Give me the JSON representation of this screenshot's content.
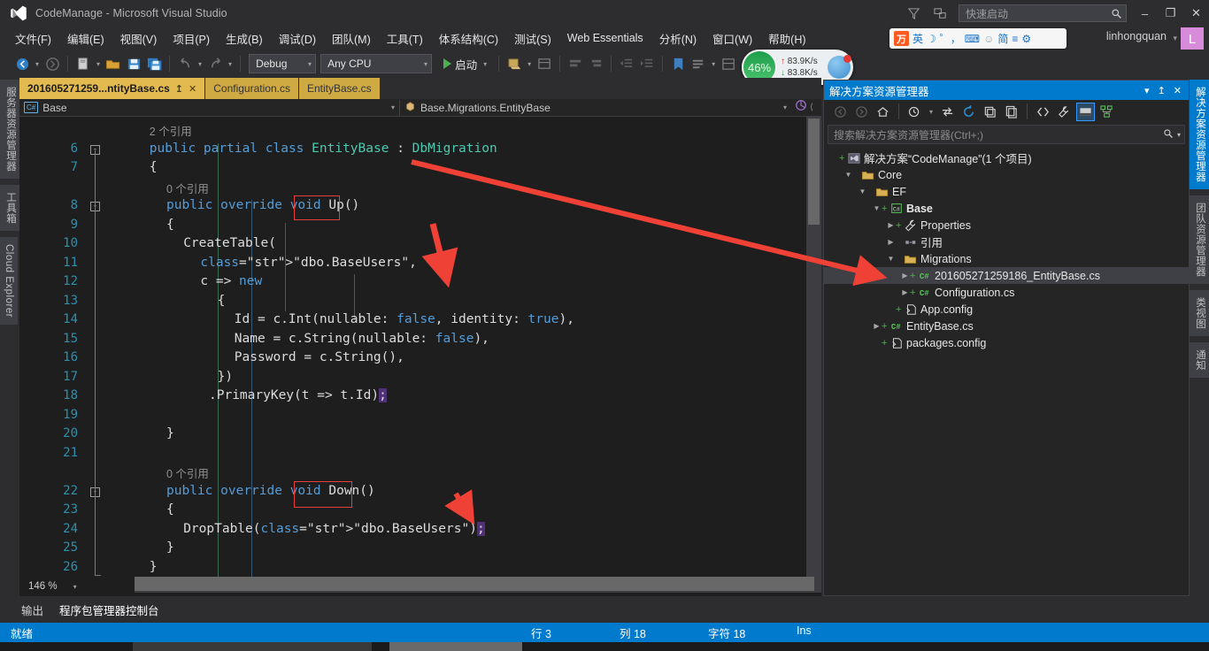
{
  "window": {
    "title": "CodeManage - Microsoft Visual Studio",
    "logo_icon": "visual-studio-logo",
    "minimize": "–",
    "maximize": "❐",
    "close": "✕"
  },
  "titlebar": {
    "feedback_icon": "feedback-smiley-icon",
    "notify_icon": "notifications-icon",
    "quick_launch_placeholder": "快速启动",
    "search_icon": "search-icon"
  },
  "account": {
    "user_name": "linhongquan",
    "avatar_letter": "L",
    "caret": "▾"
  },
  "ime": {
    "logo": "万",
    "items": [
      "英",
      "☽",
      "゜，",
      "⌨",
      "☺",
      "简",
      "≡",
      "⚙"
    ]
  },
  "menu": {
    "items": [
      "文件(F)",
      "编辑(E)",
      "视图(V)",
      "项目(P)",
      "生成(B)",
      "调试(D)",
      "团队(M)",
      "工具(T)",
      "体系结构(C)",
      "测试(S)",
      "Web Essentials",
      "分析(N)",
      "窗口(W)",
      "帮助(H)"
    ]
  },
  "toolbar": {
    "nav_back_icon": "navigate-back-icon",
    "nav_forward_icon": "navigate-forward-icon",
    "new_project_icon": "new-project-icon",
    "open_file_icon": "open-file-icon",
    "save_icon": "save-icon",
    "save_all_icon": "save-all-icon",
    "undo_icon": "undo-icon",
    "redo_icon": "redo-icon",
    "config_value": "Debug",
    "platform_value": "Any CPU",
    "run_label": "启动",
    "attach_icon": "attach-to-process-icon",
    "comment_icon": "comment-icon",
    "uncomment_icon": "uncomment-icon",
    "indent_icons": [
      "decrease-indent-icon",
      "increase-indent-icon"
    ],
    "bookmark_icon": "bookmark-icon",
    "window_layout_icon": "window-layout-icon"
  },
  "perf_widget": {
    "percent": "46%",
    "upload": "83.9K/s",
    "download": "83.8K/s",
    "up_arrow": "↑",
    "down_arrow": "↓"
  },
  "left_dock_tabs": [
    "服务器资源管理器",
    "工具箱",
    "Cloud Explorer"
  ],
  "right_dock_tabs": [
    "解决方案资源管理器",
    "团队资源管理器",
    "类视图",
    "通知"
  ],
  "editor": {
    "tabs": [
      {
        "label": "201605271259...ntityBase.cs",
        "active": true,
        "pin": "↥",
        "close": "✕"
      },
      {
        "label": "Configuration.cs",
        "active": false
      },
      {
        "label": "EntityBase.cs",
        "active": false
      }
    ],
    "breadcrumb_left": "Base",
    "breadcrumb_left_icon": "csharp-project-icon",
    "breadcrumb_right": "Base.Migrations.EntityBase",
    "breadcrumb_right_icon": "class-icon",
    "zoom_level": "146 %",
    "annotations": [
      {
        "box": "Up()"
      },
      {
        "box": "Down()"
      }
    ],
    "lines": [
      {
        "num": "",
        "indent": 3,
        "text": "2 个引用",
        "kind": "codelens"
      },
      {
        "num": "6",
        "indent": 3,
        "text": "public partial class EntityBase : DbMigration",
        "kind": "code",
        "fold": "-"
      },
      {
        "num": "7",
        "indent": 3,
        "text": "{",
        "kind": "code"
      },
      {
        "num": "",
        "indent": 5,
        "text": "0 个引用",
        "kind": "codelens"
      },
      {
        "num": "8",
        "indent": 5,
        "text": "public override void Up()",
        "kind": "code",
        "fold": "-"
      },
      {
        "num": "9",
        "indent": 5,
        "text": "{",
        "kind": "code"
      },
      {
        "num": "10",
        "indent": 7,
        "text": "CreateTable(",
        "kind": "code"
      },
      {
        "num": "11",
        "indent": 9,
        "text": "\"dbo.BaseUsers\",",
        "kind": "code"
      },
      {
        "num": "12",
        "indent": 9,
        "text": "c => new",
        "kind": "code"
      },
      {
        "num": "13",
        "indent": 11,
        "text": "{",
        "kind": "code"
      },
      {
        "num": "14",
        "indent": 13,
        "text": "Id = c.Int(nullable: false, identity: true),",
        "kind": "code"
      },
      {
        "num": "15",
        "indent": 13,
        "text": "Name = c.String(nullable: false),",
        "kind": "code"
      },
      {
        "num": "16",
        "indent": 13,
        "text": "Password = c.String(),",
        "kind": "code"
      },
      {
        "num": "17",
        "indent": 11,
        "text": "})",
        "kind": "code"
      },
      {
        "num": "18",
        "indent": 10,
        "text": ".PrimaryKey(t => t.Id);",
        "kind": "code"
      },
      {
        "num": "19",
        "indent": 0,
        "text": "",
        "kind": "code"
      },
      {
        "num": "20",
        "indent": 5,
        "text": "}",
        "kind": "code"
      },
      {
        "num": "21",
        "indent": 0,
        "text": "",
        "kind": "code"
      },
      {
        "num": "",
        "indent": 5,
        "text": "0 个引用",
        "kind": "codelens"
      },
      {
        "num": "22",
        "indent": 5,
        "text": "public override void Down()",
        "kind": "code",
        "fold": "-"
      },
      {
        "num": "23",
        "indent": 5,
        "text": "{",
        "kind": "code"
      },
      {
        "num": "24",
        "indent": 7,
        "text": "DropTable(\"dbo.BaseUsers\");",
        "kind": "code"
      },
      {
        "num": "25",
        "indent": 5,
        "text": "}",
        "kind": "code"
      },
      {
        "num": "26",
        "indent": 3,
        "text": "}",
        "kind": "code"
      }
    ]
  },
  "solution_explorer": {
    "title": "解决方案资源管理器",
    "title_buttons": [
      "▾",
      "↥",
      "✕"
    ],
    "toolbar_icons": [
      "back-icon",
      "forward-icon",
      "home-icon",
      "pending-changes-icon",
      "sync-with-active-document-icon",
      "refresh-icon",
      "collapse-all-icon",
      "show-all-files-icon",
      "view-code-icon",
      "properties-icon",
      "preview-selected-items-icon",
      "class-diagram-icon"
    ],
    "search_placeholder": "搜索解决方案资源管理器(Ctrl+;)",
    "tree": [
      {
        "depth": 0,
        "label": "解决方案“CodeManage”(1 个项目)",
        "icon": "solution-icon",
        "expander": "",
        "plus": "+",
        "bold": false,
        "selected": false
      },
      {
        "depth": 1,
        "label": "Core",
        "icon": "folder-icon",
        "expander": "▼",
        "plus": "",
        "bold": false,
        "selected": false
      },
      {
        "depth": 2,
        "label": "EF",
        "icon": "folder-icon",
        "expander": "▼",
        "plus": "",
        "bold": false,
        "selected": false
      },
      {
        "depth": 3,
        "label": "Base",
        "icon": "csharp-project-icon",
        "expander": "▼",
        "plus": "+",
        "bold": true,
        "selected": false
      },
      {
        "depth": 4,
        "label": "Properties",
        "icon": "properties-wrench-icon",
        "expander": "▶",
        "plus": "+",
        "bold": false,
        "selected": false
      },
      {
        "depth": 4,
        "label": "引用",
        "icon": "references-icon",
        "expander": "▶",
        "plus": "",
        "bold": false,
        "selected": false
      },
      {
        "depth": 4,
        "label": "Migrations",
        "icon": "folder-icon",
        "expander": "▼",
        "plus": "",
        "bold": false,
        "selected": false
      },
      {
        "depth": 5,
        "label": "201605271259186_EntityBase.cs",
        "icon": "csharp-file-icon",
        "expander": "▶",
        "plus": "+",
        "bold": false,
        "selected": true
      },
      {
        "depth": 5,
        "label": "Configuration.cs",
        "icon": "csharp-file-icon",
        "expander": "▶",
        "plus": "+",
        "bold": false,
        "selected": false
      },
      {
        "depth": 4,
        "label": "App.config",
        "icon": "config-file-icon",
        "expander": "",
        "plus": "+",
        "bold": false,
        "selected": false
      },
      {
        "depth": 3,
        "label": "EntityBase.cs",
        "icon": "csharp-file-icon",
        "expander": "▶",
        "plus": "+",
        "bold": false,
        "selected": false
      },
      {
        "depth": 3,
        "label": "packages.config",
        "icon": "config-file-icon",
        "expander": "",
        "plus": "+",
        "bold": false,
        "selected": false
      }
    ]
  },
  "bottom_panel": {
    "tabs": [
      "输出",
      "程序包管理器控制台"
    ]
  },
  "statusbar": {
    "ready": "就绪",
    "line_label": "行 3",
    "col_label": "列 18",
    "char_label": "字符 18",
    "ins_label": "Ins"
  },
  "colors": {
    "accent_blue": "#007acc",
    "tab_gold": "#e3ba4f",
    "editor_bg": "#1e1e1e",
    "chrome_bg": "#2d2d30",
    "panel_bg": "#252526",
    "annotation_red": "#e8403a",
    "keyword_blue": "#569cd6",
    "type_teal": "#4ec9b0",
    "string_orange": "#d69d85",
    "linenum_cyan": "#2b91af"
  }
}
